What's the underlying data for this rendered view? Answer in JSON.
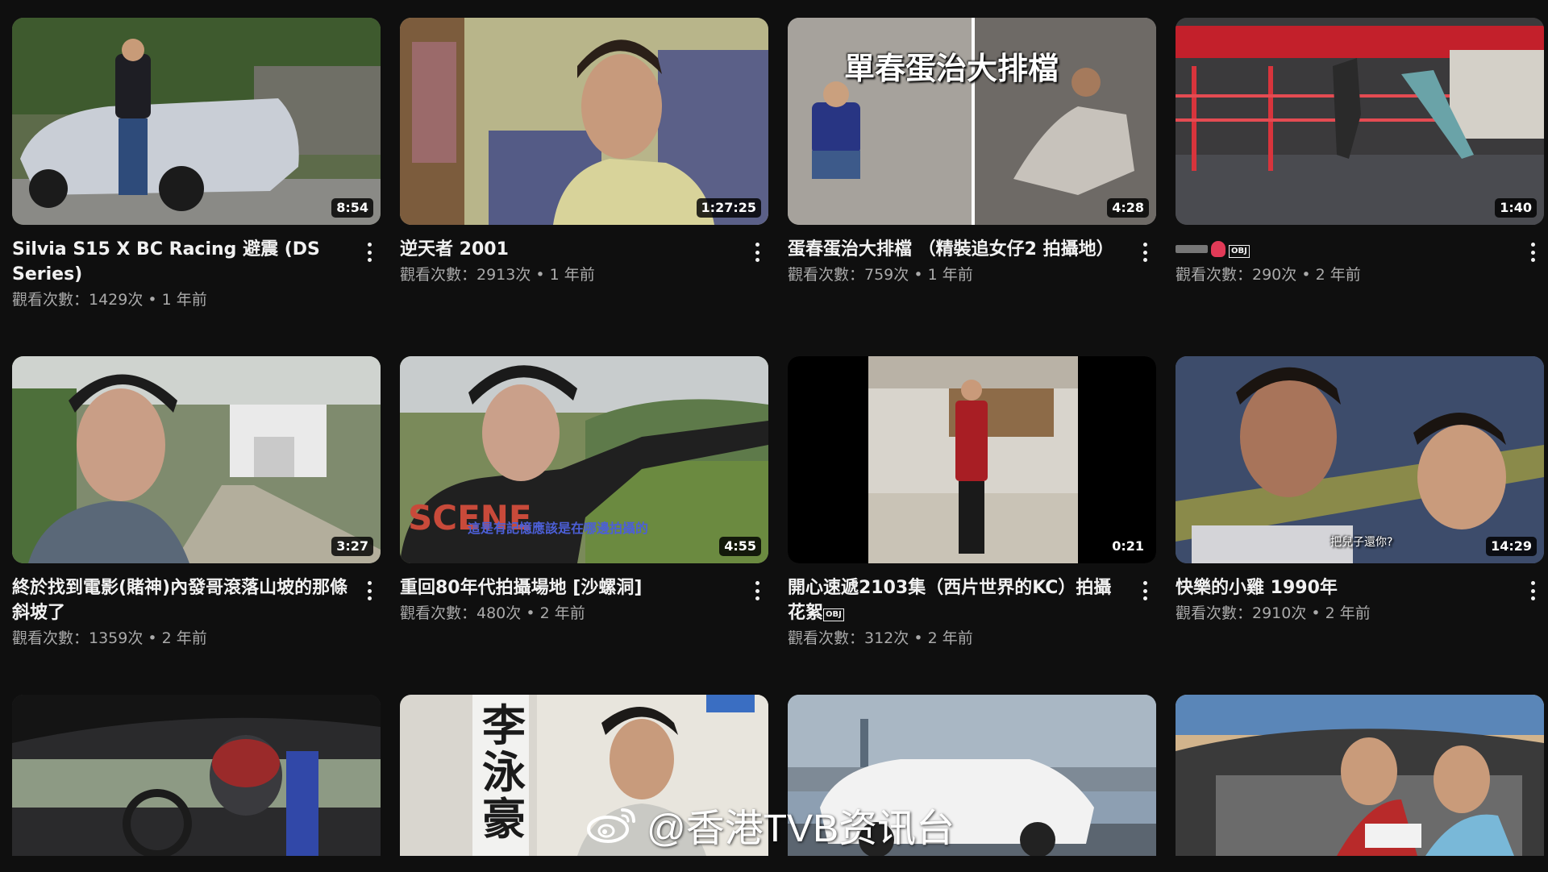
{
  "videos": [
    {
      "title": "Silvia S15 X BC Racing 避震 (DS Series)",
      "views": "觀看次數：1429次",
      "age": "1 年前",
      "duration": "8:54",
      "overlay": ""
    },
    {
      "title": "逆天者 2001",
      "views": "觀看次數：2913次",
      "age": "1 年前",
      "duration": "1:27:25",
      "overlay": ""
    },
    {
      "title": "蛋春蛋治大排檔 （精裝追女仔2 拍攝地）",
      "views": "觀看次數：759次",
      "age": "1 年前",
      "duration": "4:28",
      "overlay": "單春蛋治大排檔"
    },
    {
      "title": "",
      "views": "觀看次數：290次",
      "age": "2 年前",
      "duration": "1:40",
      "overlay": ""
    },
    {
      "title": "終於找到電影(賭神)內發哥滾落山坡的那條斜坡了",
      "views": "觀看次數：1359次",
      "age": "2 年前",
      "duration": "3:27",
      "overlay": ""
    },
    {
      "title": "重回80年代拍攝場地 [沙螺洞]",
      "views": "觀看次數：480次",
      "age": "2 年前",
      "duration": "4:55",
      "overlay": "這是有記憶應該是在哪邊拍攝的"
    },
    {
      "title": "開心速遞2103集（西片世界的KC）拍攝花絮",
      "views": "觀看次數：312次",
      "age": "2 年前",
      "duration": "0:21",
      "overlay": ""
    },
    {
      "title": "快樂的小雞 1990年",
      "views": "觀看次數：2910次",
      "age": "2 年前",
      "duration": "14:29",
      "overlay": "把兒子還你?"
    },
    {
      "title": "",
      "views": "",
      "age": "",
      "duration": "",
      "overlay": ""
    },
    {
      "title": "",
      "views": "",
      "age": "",
      "duration": "",
      "overlay": "李泳豪"
    },
    {
      "title": "",
      "views": "",
      "age": "",
      "duration": "",
      "overlay": ""
    },
    {
      "title": "",
      "views": "",
      "age": "",
      "duration": "",
      "overlay": ""
    }
  ],
  "separator": "•",
  "card4_obj": "OBJ",
  "card7_obj": "OBJ",
  "watermark": "@香港TVB资讯台",
  "colors": {
    "background": "#0f0f0f",
    "title": "#f1f1f1",
    "meta": "#aaaaaa"
  }
}
